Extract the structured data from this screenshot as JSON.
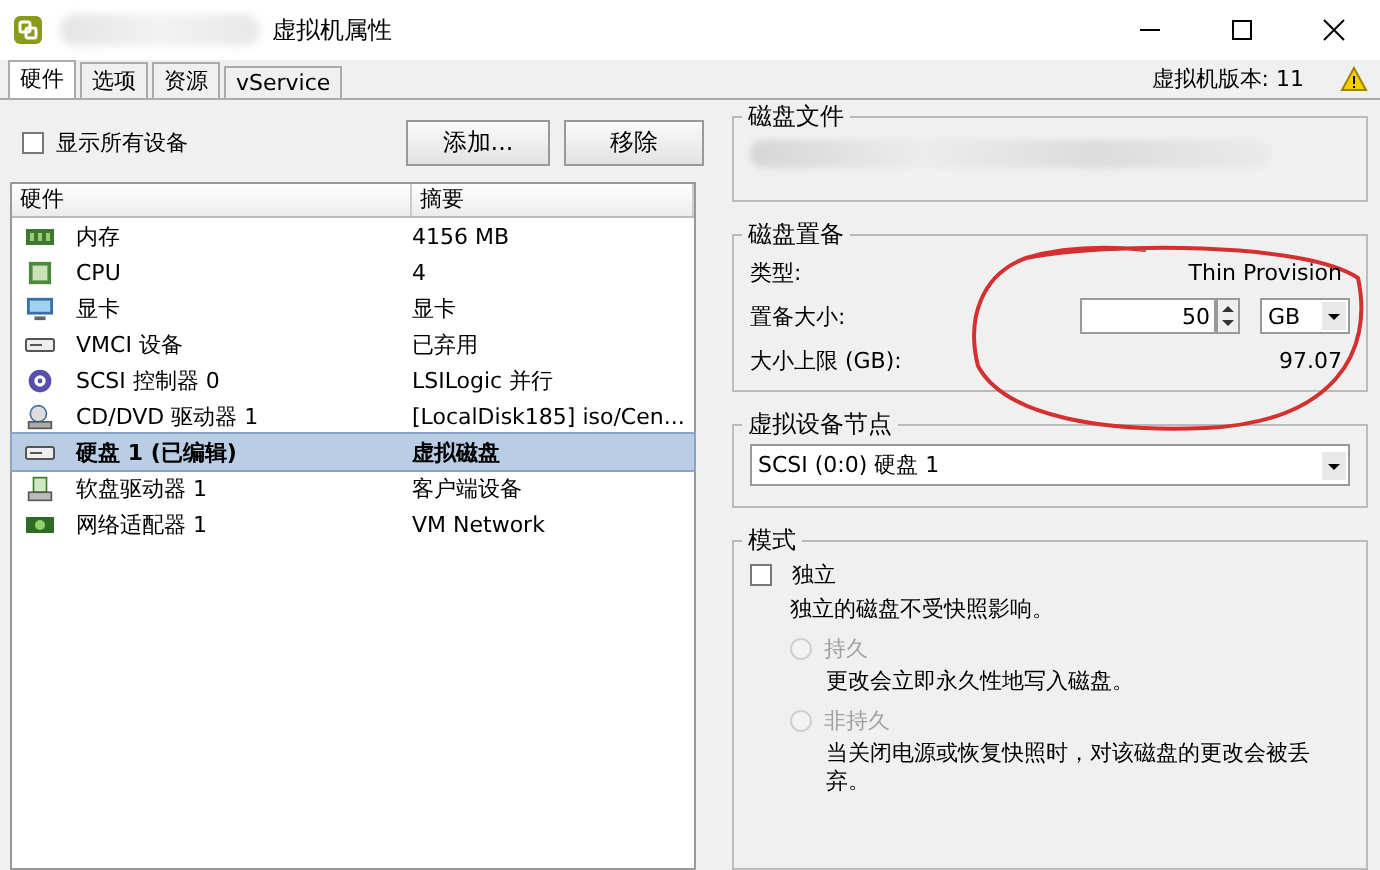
{
  "window": {
    "title": "虚拟机属性"
  },
  "tabs": [
    {
      "label": "硬件",
      "selected": true
    },
    {
      "label": "选项",
      "selected": false
    },
    {
      "label": "资源",
      "selected": false
    },
    {
      "label": "vService",
      "selected": false
    }
  ],
  "version_label": "虚拟机版本: 11",
  "show_all_devices": {
    "label": "显示所有设备",
    "checked": false
  },
  "buttons": [
    "添加...",
    "移除"
  ],
  "hardware_table": {
    "columns": [
      "硬件",
      "摘要"
    ],
    "rows": [
      {
        "kind": "memory",
        "name": "内存",
        "summary": "4156 MB",
        "selected": false,
        "edited": false
      },
      {
        "kind": "cpu",
        "name": "CPU",
        "summary": "4",
        "selected": false,
        "edited": false
      },
      {
        "kind": "display",
        "name": "显卡",
        "summary": "显卡",
        "selected": false,
        "edited": false
      },
      {
        "kind": "vmci",
        "name": "VMCI 设备",
        "summary": "已弃用",
        "selected": false,
        "edited": false
      },
      {
        "kind": "scsi",
        "name": "SCSI 控制器 0",
        "summary": "LSILogic 并行",
        "selected": false,
        "edited": false
      },
      {
        "kind": "cdrom",
        "name": "CD/DVD 驱动器 1",
        "summary": "[LocalDisk185] iso/Cen...",
        "selected": false,
        "edited": false
      },
      {
        "kind": "disk",
        "name": "硬盘 1 (已编辑)",
        "summary": "虚拟磁盘",
        "selected": true,
        "edited": true
      },
      {
        "kind": "floppy",
        "name": "软盘驱动器 1",
        "summary": "客户端设备",
        "selected": false,
        "edited": false
      },
      {
        "kind": "network",
        "name": "网络适配器 1",
        "summary": "VM Network",
        "selected": false,
        "edited": false
      }
    ]
  },
  "disk_file": {
    "title": "磁盘文件"
  },
  "provisioning": {
    "title": "磁盘置备",
    "type_label": "类型:",
    "type_value": "Thin Provision",
    "size_label": "置备大小:",
    "size_value": "50",
    "unit": "GB",
    "max_label": "大小上限 (GB):",
    "max_value": "97.07"
  },
  "device_node": {
    "title": "虚拟设备节点",
    "value": "SCSI (0:0) 硬盘 1"
  },
  "mode": {
    "title": "模式",
    "independent": {
      "label": "独立",
      "checked": false
    },
    "note": "独立的磁盘不受快照影响。",
    "options": [
      {
        "label": "持久",
        "selected": false,
        "disabled": true,
        "description": "更改会立即永久性地写入磁盘。"
      },
      {
        "label": "非持久",
        "selected": false,
        "disabled": true,
        "description": "当关闭电源或恢复快照时，对该磁盘的更改会被丢弃。"
      }
    ]
  }
}
